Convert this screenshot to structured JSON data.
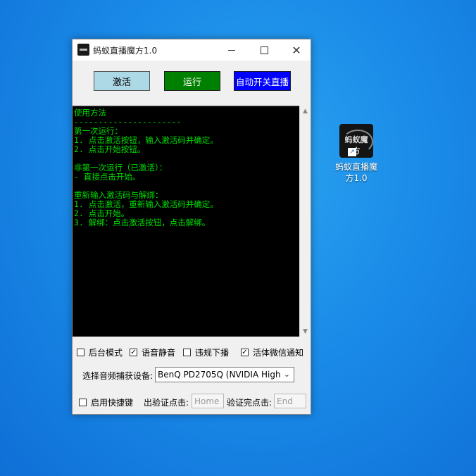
{
  "window": {
    "title": "蚂蚁直播魔方1.0",
    "controls": {
      "minimize": "—",
      "maximize": "☐",
      "close": "✕"
    }
  },
  "toolbar": {
    "activate_label": "激活",
    "run_label": "运行",
    "auto_label": "自动开关直播"
  },
  "console": {
    "lines": [
      "使用方法",
      "----------------------",
      "第一次运行：",
      "1. 点击激活按钮，输入激活码并确定。",
      "2. 点击开始按钮。",
      "",
      "非第一次运行（已激活）：",
      "- 直接点击开始。",
      "",
      "重新输入激活码与解绑：",
      "1. 点击激活，重新输入激活码并确定。",
      "2. 点击开始。",
      "3. 解绑：点击激活按钮，点击解绑。"
    ],
    "text_color": "#00e000",
    "background": "#000000"
  },
  "options": [
    {
      "label": "后台模式",
      "checked": false,
      "mark": ""
    },
    {
      "label": "语音静音",
      "checked": true,
      "mark": "✓"
    },
    {
      "label": "违规下播",
      "checked": false,
      "mark": ""
    },
    {
      "label": "活体微信通知",
      "checked": true,
      "mark": "✓"
    }
  ],
  "audio": {
    "label": "选择音频捕获设备:",
    "selected": "BenQ PD2705Q (NVIDIA High"
  },
  "bottom": {
    "hotkey_label": "启用快捷键",
    "hotkey_checked": false,
    "start_label": "出验证点击:",
    "start_placeholder": "Home",
    "end_label": "验证完点击:",
    "end_placeholder": "End"
  },
  "desktop_icon": {
    "logo_text": "蚂蚁魔方",
    "label_line1": "蚂蚁直播魔",
    "label_line2": "方1.0"
  },
  "colors": {
    "activate_bg": "#add8e6",
    "run_bg": "#008000",
    "auto_bg": "#0000ff"
  }
}
